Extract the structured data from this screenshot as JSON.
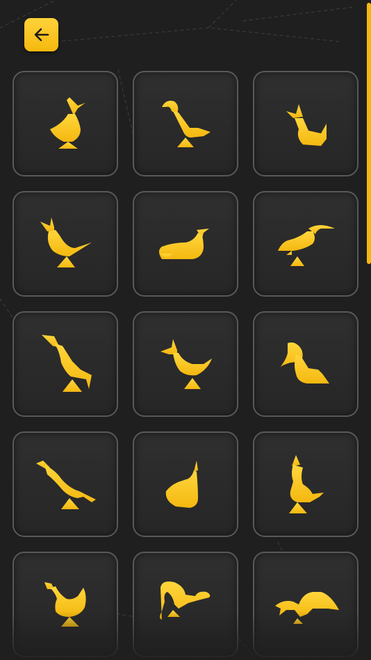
{
  "screen": "bird-level-select",
  "colors": {
    "accent": "#f5b90e",
    "tile_border": "#595959",
    "background": "#1f1f1f"
  },
  "toolbar": {
    "back_icon": "arrow-left-icon"
  },
  "levels": [
    {
      "shape": "bird-1"
    },
    {
      "shape": "bird-2"
    },
    {
      "shape": "bird-3"
    },
    {
      "shape": "bird-4"
    },
    {
      "shape": "bird-5"
    },
    {
      "shape": "bird-6"
    },
    {
      "shape": "bird-7"
    },
    {
      "shape": "bird-8"
    },
    {
      "shape": "bird-9"
    },
    {
      "shape": "bird-10"
    },
    {
      "shape": "bird-11"
    },
    {
      "shape": "bird-12"
    },
    {
      "shape": "bird-13"
    },
    {
      "shape": "bird-14"
    },
    {
      "shape": "bird-15"
    }
  ]
}
